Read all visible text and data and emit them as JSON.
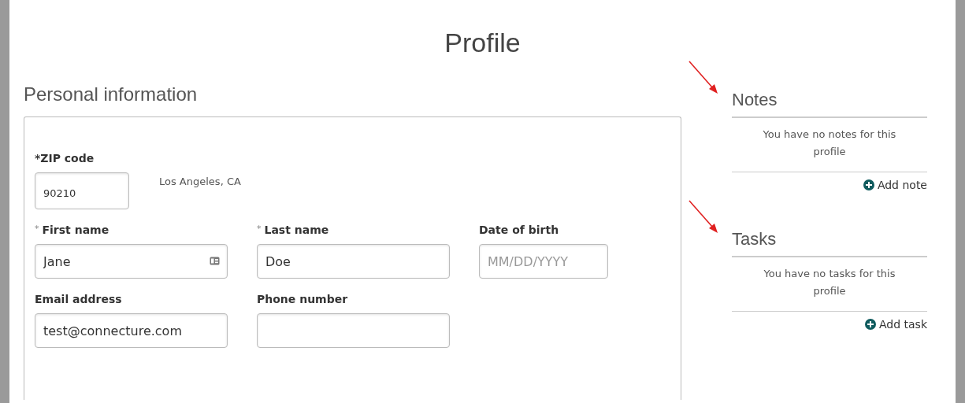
{
  "title": "Profile",
  "personal": {
    "heading": "Personal information",
    "zip": {
      "label": "*ZIP code",
      "value": "90210",
      "city": "Los Angeles, CA"
    },
    "rows": [
      [
        {
          "marker": "*",
          "label": "First name",
          "kind": "contact",
          "value": "Jane"
        },
        {
          "marker": "*",
          "label": "Last name",
          "kind": "text",
          "value": "Doe"
        },
        {
          "label": "Date of birth",
          "kind": "date",
          "placeholder": "MM/DD/YYYY"
        }
      ],
      [
        {
          "label": "Email address",
          "kind": "text",
          "value": "test@connecture.com"
        },
        {
          "label": "Phone number",
          "kind": "text"
        }
      ]
    ]
  },
  "panels": [
    {
      "heading": "Notes",
      "empty": "You have no notes for this profile",
      "action": "Add note"
    },
    {
      "heading": "Tasks",
      "empty": "You have no tasks for this profile",
      "action": "Add task"
    }
  ]
}
